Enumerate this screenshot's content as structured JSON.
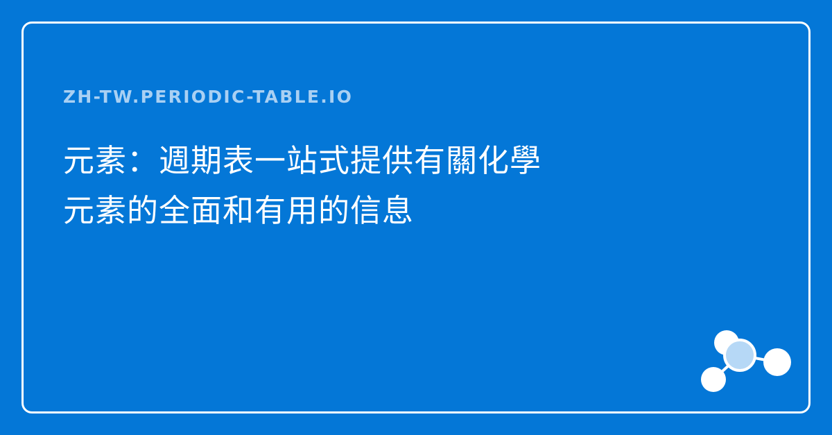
{
  "site": {
    "domain": "ZH-TW.PERIODIC-TABLE.IO"
  },
  "headline": {
    "line1": "元素：週期表一站式提供有關化學",
    "line2": "元素的全面和有用的信息"
  },
  "colors": {
    "background": "#0477d7",
    "border": "#ffffff",
    "domain_text": "#a9d0f3",
    "headline_text": "#ffffff",
    "molecule_center": "#b6d8f6",
    "molecule_atoms": "#ffffff"
  },
  "icons": {
    "logo": "molecule-icon"
  }
}
